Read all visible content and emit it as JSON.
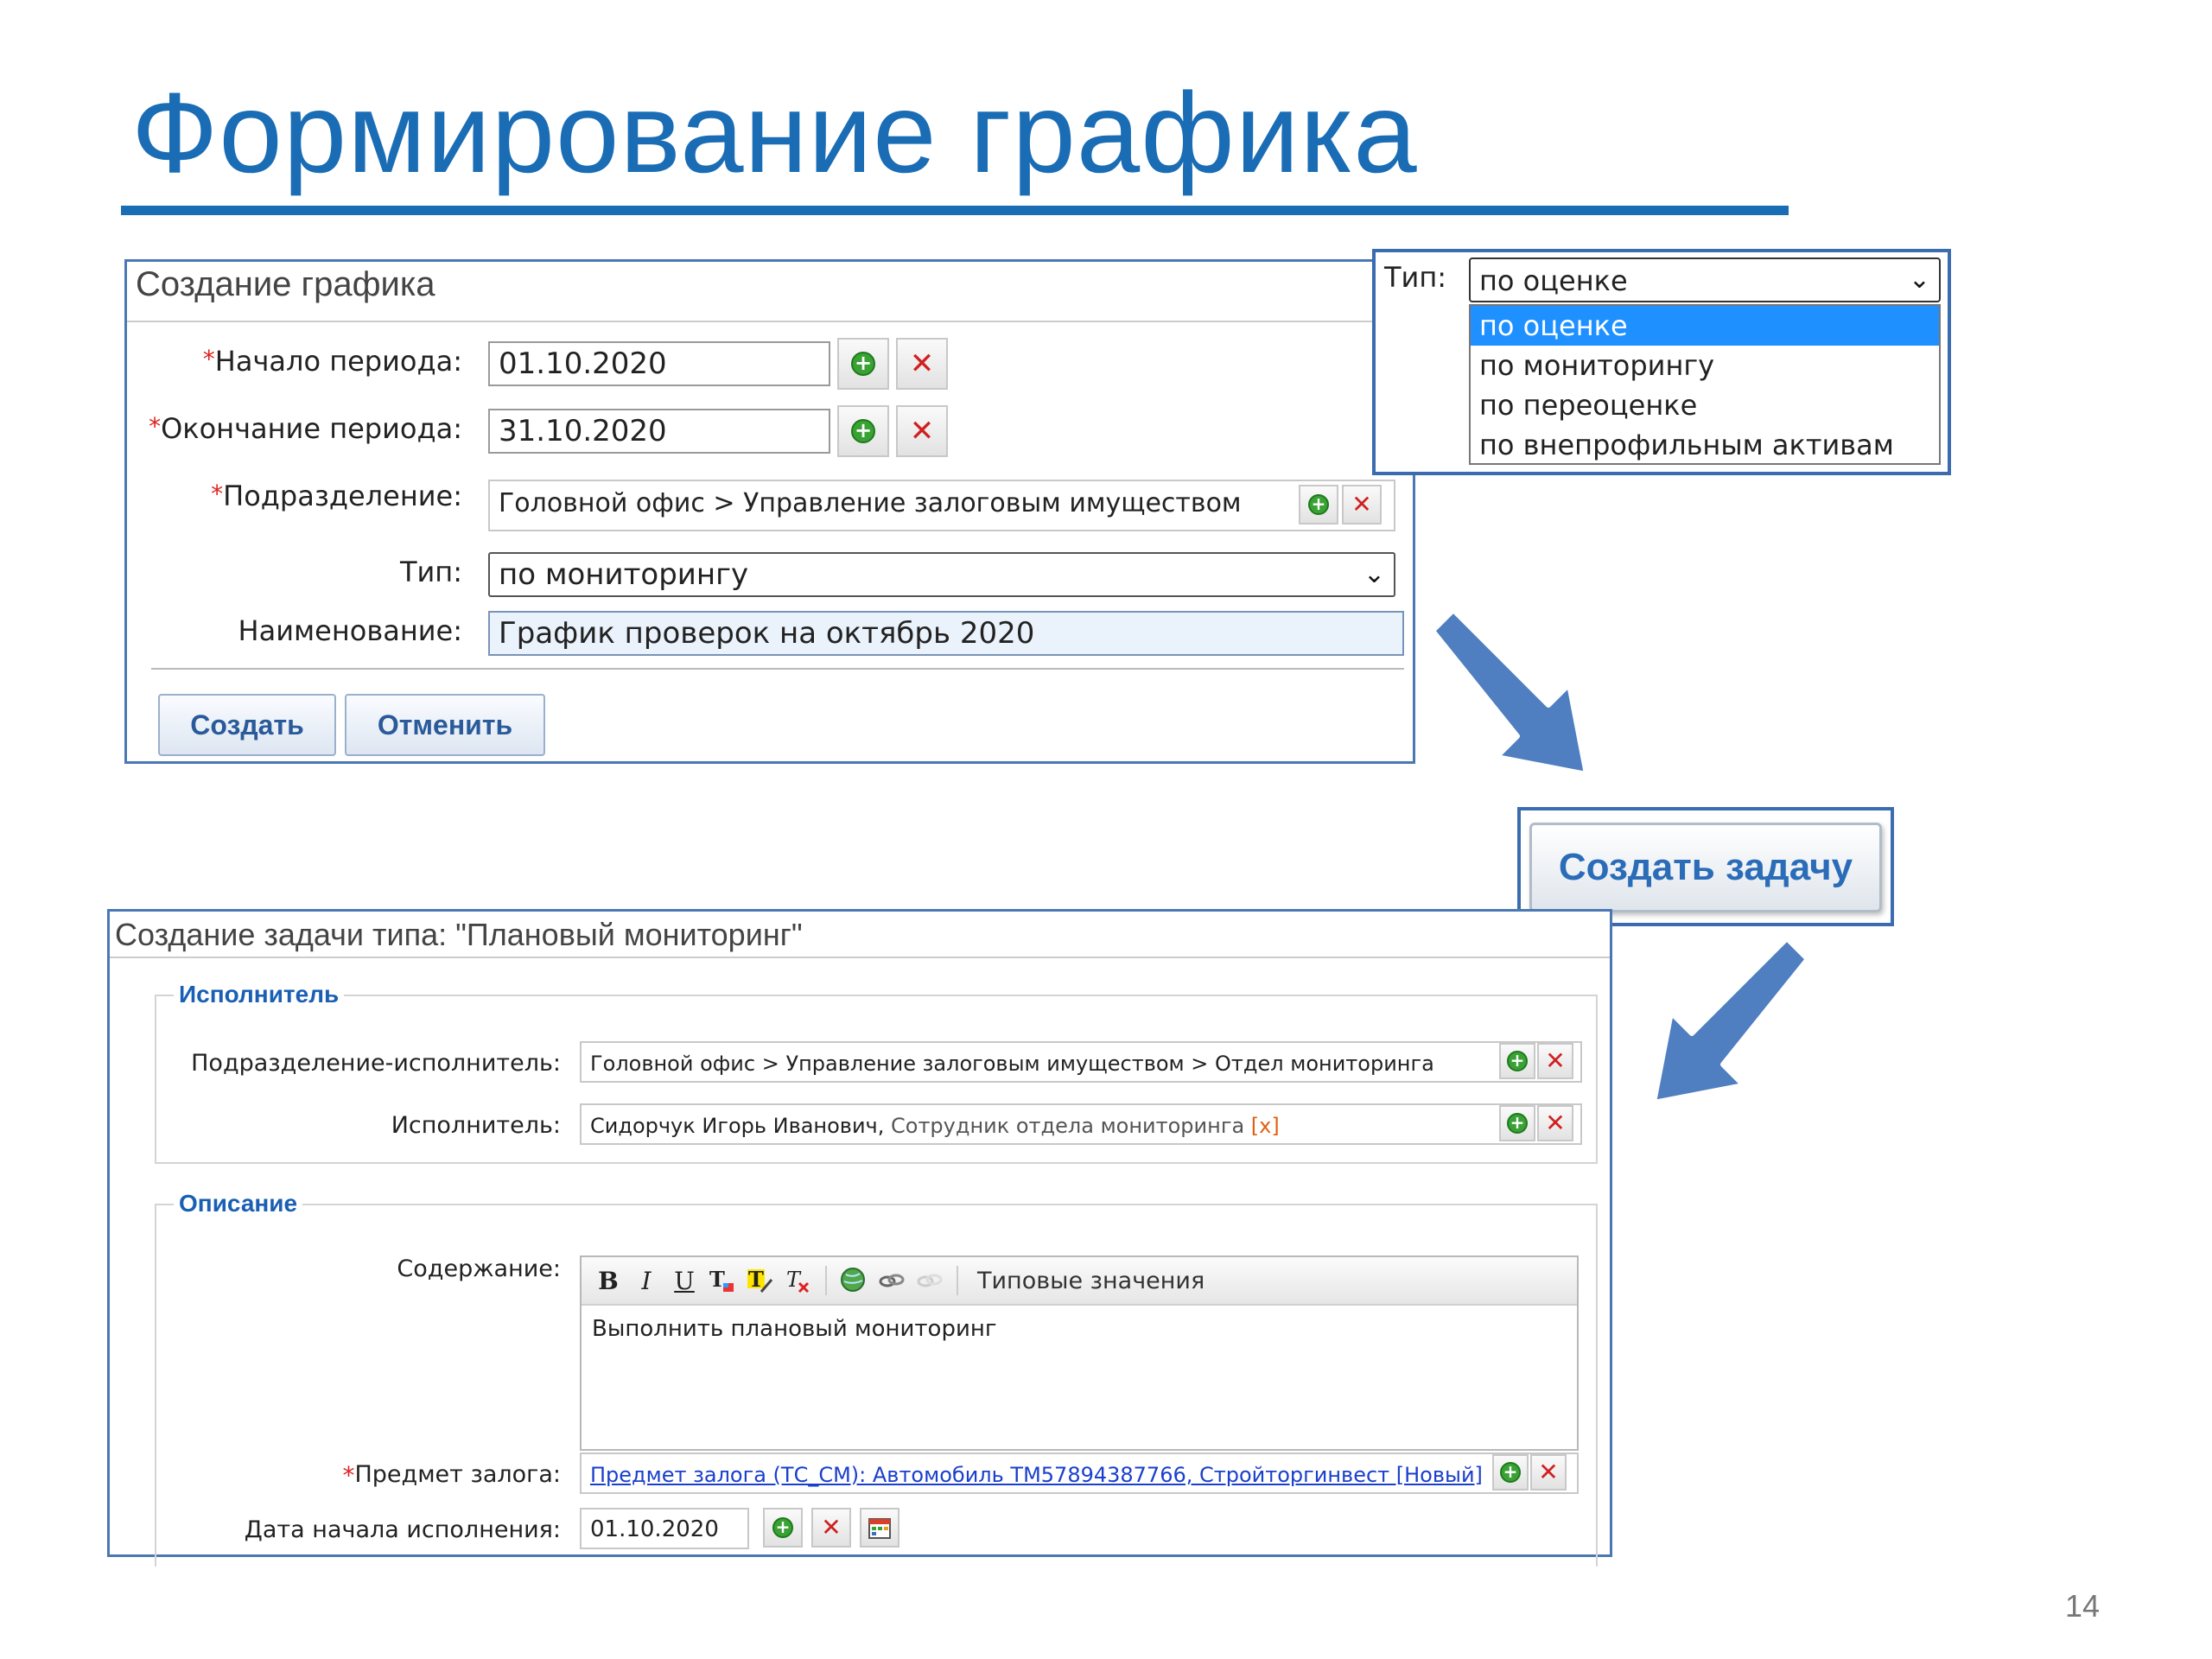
{
  "slide": {
    "title": "Формирование графика",
    "page_number": "14"
  },
  "schedule_form": {
    "title": "Создание графика",
    "required_mark": "*",
    "period_start": {
      "label": "Начало периода:",
      "value": "01.10.2020"
    },
    "period_end": {
      "label": "Окончание периода:",
      "value": "31.10.2020"
    },
    "department": {
      "label": "Подразделение:",
      "value": "Головной офис > Управление залоговым имуществом"
    },
    "type": {
      "label": "Тип:",
      "value": "по мониторингу"
    },
    "name": {
      "label": "Наименование:",
      "value": "График проверок на октябрь 2020"
    },
    "create_label": "Создать",
    "cancel_label": "Отменить"
  },
  "type_dropdown": {
    "label": "Тип:",
    "selected": "по оценке",
    "options": [
      "по оценке",
      "по мониторингу",
      "по переоценке",
      "по внепрофильным активам"
    ]
  },
  "create_task_label": "Создать задачу",
  "task_form": {
    "title": "Создание задачи типа: \"Плановый мониторинг\"",
    "executor_section": "Исполнитель",
    "exec_department": {
      "label": "Подразделение-исполнитель:",
      "value": "Головной офис > Управление залоговым имуществом > Отдел мониторинга"
    },
    "executor": {
      "label": "Исполнитель:",
      "name": "Сидорчук Игорь Иванович,",
      "role": "Сотрудник отдела мониторинга",
      "remove": "[x]"
    },
    "description_section": "Описание",
    "content": {
      "label": "Содержание:",
      "toolbar": {
        "bold": "B",
        "italic": "I",
        "underline": "U",
        "templates": "Типовые значения"
      },
      "value": "Выполнить плановый мониторинг"
    },
    "collateral": {
      "label": "Предмет залога:",
      "value": "Предмет залога (ТС_СМ): Автомобиль ТМ57894387766, Стройторгинвест [Новый]"
    },
    "start_date": {
      "label": "Дата начала исполнения:",
      "value": "01.10.2020"
    }
  },
  "colors": {
    "accent": "#1a6db5",
    "border": "#4a78b4",
    "plus_green": "#3aa235",
    "cross_red": "#d02020",
    "selected_blue": "#1e90ff"
  }
}
